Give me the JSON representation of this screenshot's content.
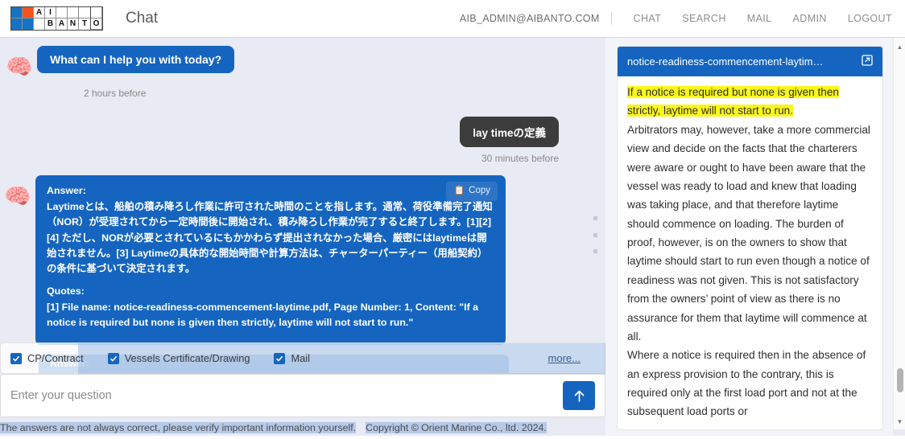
{
  "header": {
    "logo": {
      "alt": "AI BANTO logo",
      "top_row": [
        "",
        "",
        "A",
        "I",
        "",
        "",
        ""
      ],
      "bottom_row": [
        "",
        "",
        "",
        "B",
        "A",
        "N",
        "T",
        "O"
      ],
      "blue": "#1673c4",
      "orange": "#f4541d"
    },
    "app_title": "Chat",
    "user_email": "AIB_ADMIN@AIBANTO.COM",
    "nav": [
      {
        "label": "CHAT",
        "name": "nav-chat"
      },
      {
        "label": "SEARCH",
        "name": "nav-search"
      },
      {
        "label": "MAIL",
        "name": "nav-mail"
      },
      {
        "label": "ADMIN",
        "name": "nav-admin"
      },
      {
        "label": "LOGOUT",
        "name": "nav-logout"
      }
    ]
  },
  "chat": {
    "avatar_icon": "brain-icon",
    "greeting": "What can I help you with today?",
    "greeting_timestamp": "2 hours before",
    "user_message": "lay timeの定義",
    "user_timestamp": "30 minutes before",
    "copy_label": "Copy",
    "copy_icon": "clipboard-icon",
    "answer_label": "Answer:",
    "answer_body": "Laytimeとは、船舶の積み降ろし作業に許可された時間のことを指します。通常、荷役準備完了通知（NOR）が受理されてから一定時間後に開始され、積み降ろし作業が完了すると終了します。[1][2][4] ただし、NORが必要とされているにもかかわらず提出されなかった場合、厳密にはlaytimeは開始されません。[3] Laytimeの具体的な開始時間や計算方法は、チャーターパーティー（用船契約）の条件に基づいて決定されます。",
    "quotes_label": "Quotes:",
    "quote_1": "[1] File name: notice-readiness-commencement-laytime.pdf, Page Number: 1, Content: \"If a notice is required but none is given then strictly, laytime will not start to run.\"",
    "next_answer_peek": "Answer:"
  },
  "filters": {
    "items": [
      {
        "label": "CP/Contract",
        "checked": true,
        "name": "filter-cp-contract"
      },
      {
        "label": "Vessels Certificate/Drawing",
        "checked": true,
        "name": "filter-vessels-certificate"
      },
      {
        "label": "Mail",
        "checked": true,
        "name": "filter-mail"
      }
    ],
    "more_label": "more..."
  },
  "input": {
    "placeholder": "Enter your question",
    "value": "",
    "send_icon": "arrow-up-icon"
  },
  "footer": {
    "disclaimer": "The answers are not always correct, please verify important information yourself.",
    "copyright": "Copyright © Orient Marine Co., ltd. 2024."
  },
  "document": {
    "title": "notice-readiness-commencement-laytim…",
    "open_icon": "external-link-icon",
    "highlighted_text": "If a notice is required but none is given then strictly, laytime will not start to run.",
    "paragraph_1": "Arbitrators may, however, take a more commercial view and decide on the facts that the charterers were aware or ought to have been aware that the vessel was ready to load and knew that loading was taking place, and that therefore laytime should commence on loading. The burden of proof, however, is on the owners to show that laytime should start to run even though a notice of readiness was not given. This is not satisfactory from the owners’ point of view as there is no assurance for them that laytime will commence at all.",
    "paragraph_2": "Where a notice is required then in the absence of an express provision to the contrary, this is required only at the first load port and not at the subsequent load ports or"
  },
  "colors": {
    "accent_blue": "#1565c0",
    "user_bubble": "#3c3c3c",
    "highlight_yellow": "#fbf719",
    "chat_background": "#e8eaf4"
  }
}
